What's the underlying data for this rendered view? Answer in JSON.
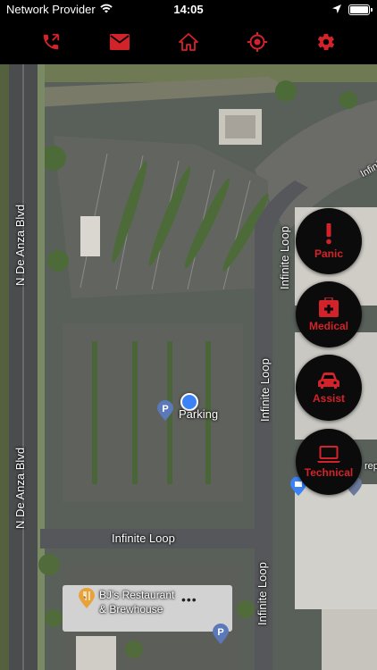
{
  "status_bar": {
    "carrier": "Network Provider",
    "time": "14:05",
    "battery_level": 0.9
  },
  "toolbar": {
    "icons": [
      "phone-call-icon",
      "mail-icon",
      "home-icon",
      "location-target-icon",
      "settings-gear-icon"
    ],
    "accent_color": "#d3232a"
  },
  "map": {
    "streets": {
      "n_de_anza_top": "N De Anza Blvd",
      "n_de_anza_bottom": "N De Anza Blvd",
      "infinite_loop_upper": "Infinite Loop",
      "infinite_loop_mid": "Infinite Loop",
      "infinite_loop_lower": "Infinite Loop",
      "infinite_loop_horizontal": "Infinite Loop",
      "infinite_loop_edge": "Infini",
      "edge_fragment": "rep"
    },
    "places": {
      "parking": "Parking",
      "restaurant_line1": "BJ's Restaurant",
      "restaurant_line2": "& Brewhouse"
    }
  },
  "actions": {
    "panic": "Panic",
    "medical": "Medical",
    "assist": "Assist",
    "technical": "Technical"
  }
}
